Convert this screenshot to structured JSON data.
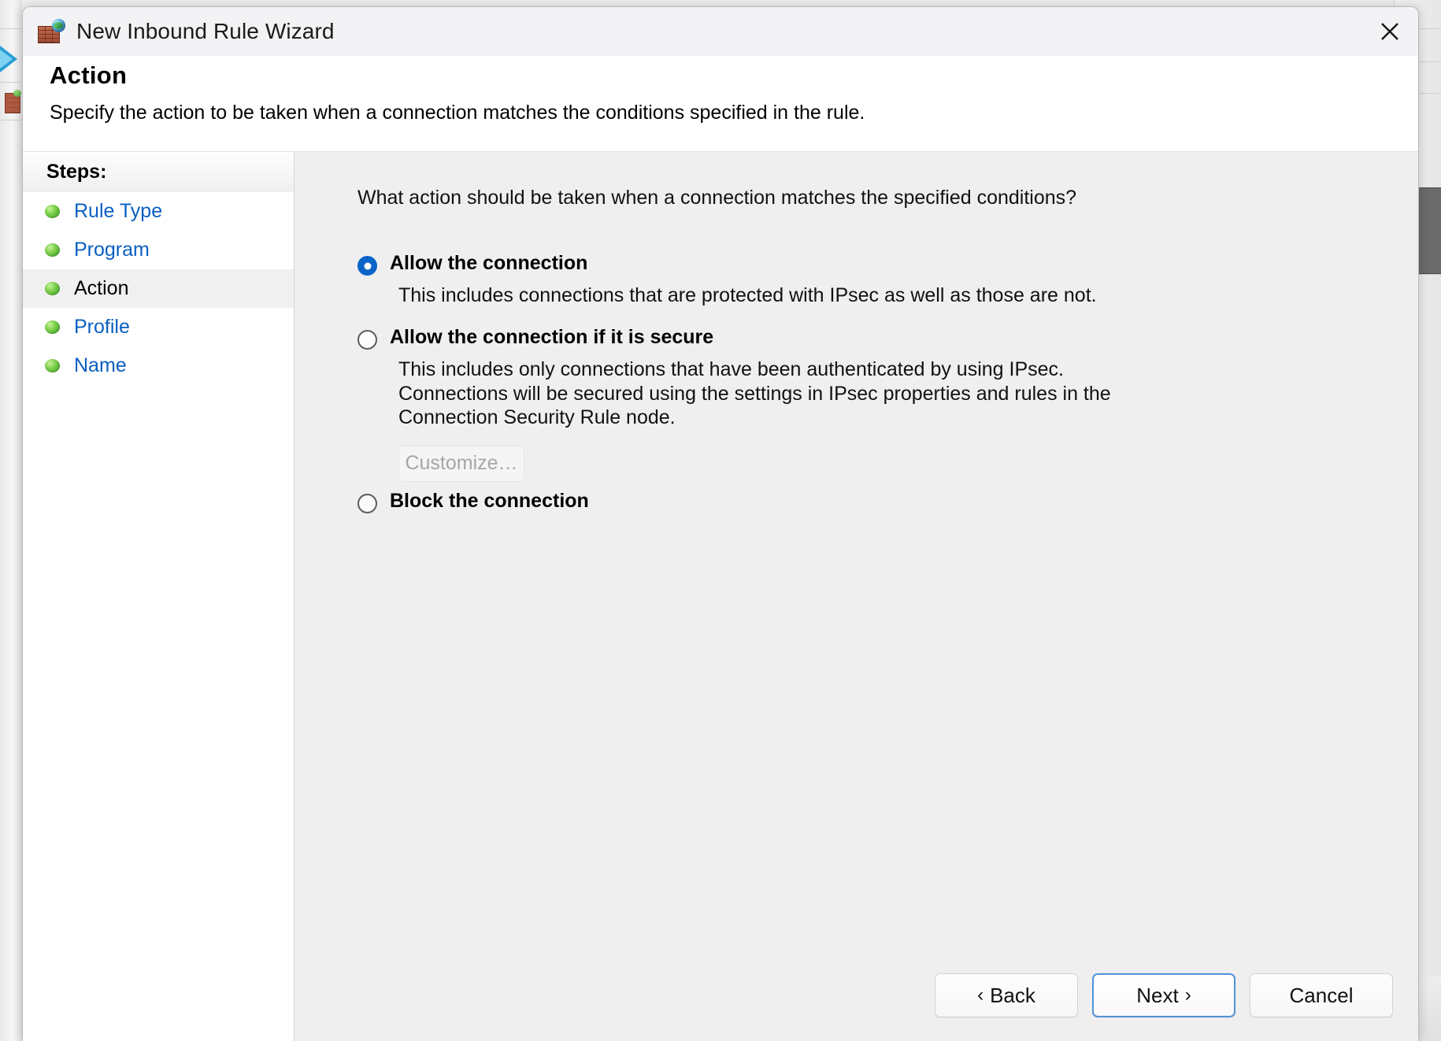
{
  "window": {
    "title": "New Inbound Rule Wizard",
    "app_icon": "firewall-globe-icon",
    "close_icon": "close-icon"
  },
  "header": {
    "title": "Action",
    "subtitle": "Specify the action to be taken when a connection matches the conditions specified in the rule."
  },
  "sidebar": {
    "heading": "Steps:",
    "items": [
      {
        "label": "Rule Type",
        "state": "completed"
      },
      {
        "label": "Program",
        "state": "completed"
      },
      {
        "label": "Action",
        "state": "current"
      },
      {
        "label": "Profile",
        "state": "completed"
      },
      {
        "label": "Name",
        "state": "completed"
      }
    ]
  },
  "main": {
    "question": "What action should be taken when a connection matches the specified conditions?",
    "options": [
      {
        "id": "allow",
        "label": "Allow the connection",
        "selected": true,
        "description_lines": [
          "This includes connections that are protected with IPsec as well as those are not."
        ]
      },
      {
        "id": "allow-secure",
        "label": "Allow the connection if it is secure",
        "selected": false,
        "description_lines": [
          "This includes only connections that have been authenticated by using IPsec.",
          "Connections will be secured using the settings in IPsec properties and rules in the",
          "Connection Security Rule node."
        ],
        "customize_button": {
          "label": "Customize…",
          "enabled": false
        }
      },
      {
        "id": "block",
        "label": "Block the connection",
        "selected": false,
        "description_lines": []
      }
    ]
  },
  "footer": {
    "back_label": "Back",
    "back_chevron": "‹",
    "next_label": "Next",
    "next_chevron": "›",
    "cancel_label": "Cancel"
  },
  "colors": {
    "accent": "#0a64c8",
    "link": "#0a5fc2",
    "default_button_border": "#4f93d6",
    "titlebar": "#f3f2f4",
    "content_bg": "#efefef"
  }
}
